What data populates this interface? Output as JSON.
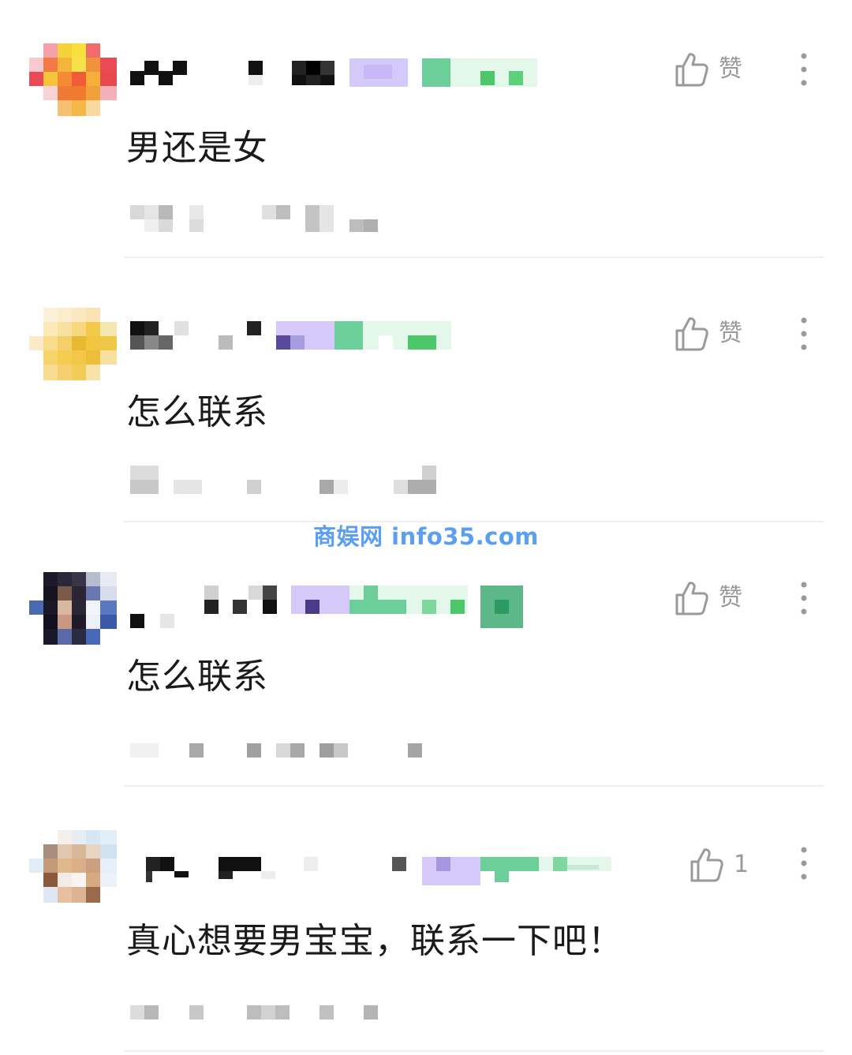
{
  "comments": [
    {
      "text": "男还是女",
      "like_label": "赞",
      "like_icon": "thumbs-up-icon",
      "more_icon": "more-vertical-icon"
    },
    {
      "text": "怎么联系",
      "like_label": "赞",
      "like_icon": "thumbs-up-icon",
      "more_icon": "more-vertical-icon"
    },
    {
      "text": "怎么联系",
      "like_label": "赞",
      "like_icon": "thumbs-up-icon",
      "more_icon": "more-vertical-icon"
    },
    {
      "text": "真心想要男宝宝，联系一下吧！",
      "like_label": "1",
      "like_icon": "thumbs-up-icon",
      "more_icon": "more-vertical-icon"
    }
  ],
  "watermark": "商娱网 info35.com",
  "colors": {
    "comment_text": "#1a1a1a",
    "muted_icon": "#9a9a9a",
    "divider": "#efefef",
    "watermark": "#3f8ff0"
  }
}
